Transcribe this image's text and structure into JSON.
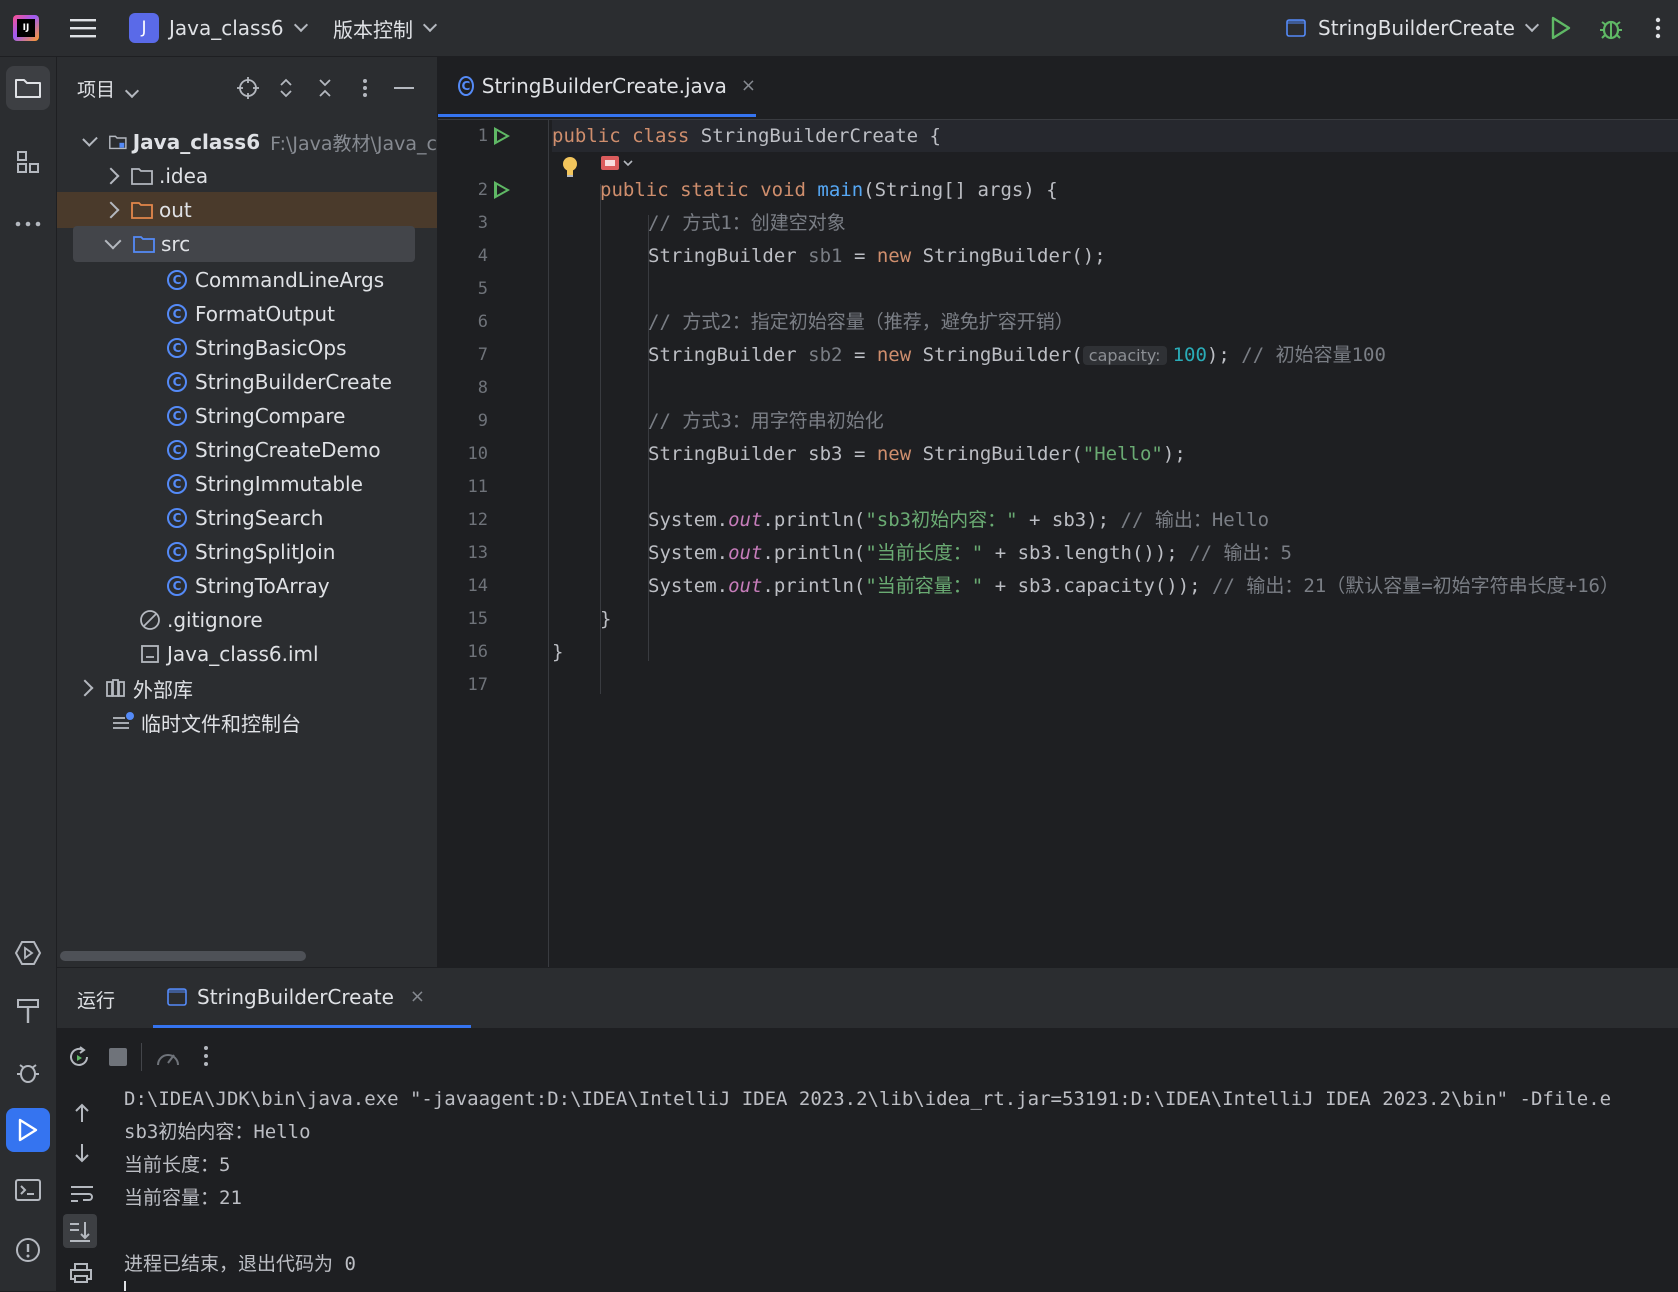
{
  "titlebar": {
    "project_badge": "J",
    "project_name": "Java_class6",
    "vcs_label": "版本控制",
    "run_config": "StringBuilderCreate",
    "icons": [
      "app-logo-icon",
      "hamburger-menu-icon",
      "run-icon",
      "debug-icon",
      "more-vertical-icon"
    ]
  },
  "project_panel": {
    "title": "项目",
    "tree": [
      {
        "label": "Java_class6",
        "path": "F:\\Java教材\\Java_c",
        "kind": "module"
      },
      {
        "label": ".idea",
        "kind": "folder"
      },
      {
        "label": "out",
        "kind": "folder-excluded"
      },
      {
        "label": "src",
        "kind": "source-folder"
      },
      {
        "label": "CommandLineArgs",
        "kind": "class"
      },
      {
        "label": "FormatOutput",
        "kind": "class"
      },
      {
        "label": "StringBasicOps",
        "kind": "class"
      },
      {
        "label": "StringBuilderCreate",
        "kind": "class"
      },
      {
        "label": "StringCompare",
        "kind": "class"
      },
      {
        "label": "StringCreateDemo",
        "kind": "class"
      },
      {
        "label": "StringImmutable",
        "kind": "class"
      },
      {
        "label": "StringSearch",
        "kind": "class"
      },
      {
        "label": "StringSplitJoin",
        "kind": "class"
      },
      {
        "label": "StringToArray",
        "kind": "class"
      },
      {
        "label": ".gitignore",
        "kind": "ignore-file"
      },
      {
        "label": "Java_class6.iml",
        "kind": "iml-file"
      },
      {
        "label": "外部库",
        "kind": "library"
      },
      {
        "label": "临时文件和控制台",
        "kind": "scratches"
      }
    ]
  },
  "editor": {
    "tab_label": "StringBuilderCreate.java",
    "tab_close": "×",
    "line_numbers": [
      "1",
      "2",
      "3",
      "4",
      "5",
      "6",
      "7",
      "8",
      "9",
      "10",
      "11",
      "12",
      "13",
      "14",
      "15",
      "16",
      "17"
    ],
    "code": {
      "l1_kw1": "public",
      "l1_kw2": "class",
      "l1_name": "StringBuilderCreate",
      "l1_brace": "{",
      "l2_kw1": "public",
      "l2_kw2": "static",
      "l2_kw3": "void",
      "l2_fn": "main",
      "l2_params": "(String[] args) {",
      "l3_comment": "// 方式1：创建空对象",
      "l4_type": "StringBuilder",
      "l4_var": "sb1",
      "l4_eq": "=",
      "l4_new": "new",
      "l4_ctor": "StringBuilder();",
      "l6_comment": "// 方式2：指定初始容量（推荐，避免扩容开销）",
      "l7_type": "StringBuilder",
      "l7_var": "sb2",
      "l7_eq": "=",
      "l7_new": "new",
      "l7_ctor": "StringBuilder(",
      "l7_hint": "capacity:",
      "l7_num": "100",
      "l7_end": ");",
      "l7_comment": "// 初始容量100",
      "l9_comment": "// 方式3：用字符串初始化",
      "l10_type": "StringBuilder",
      "l10_var": "sb3",
      "l10_eq": "=",
      "l10_new": "new",
      "l10_ctor": "StringBuilder(",
      "l10_str": "\"Hello\"",
      "l10_end": ");",
      "l12_sys": "System.",
      "l12_out": "out",
      "l12_println": ".println(",
      "l12_str": "\"sb3初始内容：\"",
      "l12_rest": " + sb3);",
      "l12_comment": "// 输出：Hello",
      "l13_sys": "System.",
      "l13_out": "out",
      "l13_println": ".println(",
      "l13_str": "\"当前长度：\"",
      "l13_rest": " + sb3.length());",
      "l13_comment": "// 输出：5",
      "l14_sys": "System.",
      "l14_out": "out",
      "l14_println": ".println(",
      "l14_str": "\"当前容量：\"",
      "l14_rest": " + sb3.capacity());",
      "l14_comment": "// 输出：21（默认容量=初始字符串长度+16）",
      "l15": "}",
      "l16": "}"
    }
  },
  "run_panel": {
    "title": "运行",
    "tab_label": "StringBuilderCreate",
    "tab_close": "×",
    "console": [
      "D:\\IDEA\\JDK\\bin\\java.exe \"-javaagent:D:\\IDEA\\IntelliJ IDEA 2023.2\\lib\\idea_rt.jar=53191:D:\\IDEA\\IntelliJ IDEA 2023.2\\bin\" -Dfile.e",
      "sb3初始内容：Hello",
      "当前长度：5",
      "当前容量：21",
      "",
      "进程已结束，退出代码为 0"
    ]
  },
  "colors": {
    "accent": "#3574f0",
    "run_green": "#5fb865",
    "keyword": "#cf8e6d",
    "string": "#6aab73",
    "comment": "#7a7e85",
    "number": "#2aacb8",
    "function": "#56a8f5",
    "static_field": "#c77dbb"
  }
}
